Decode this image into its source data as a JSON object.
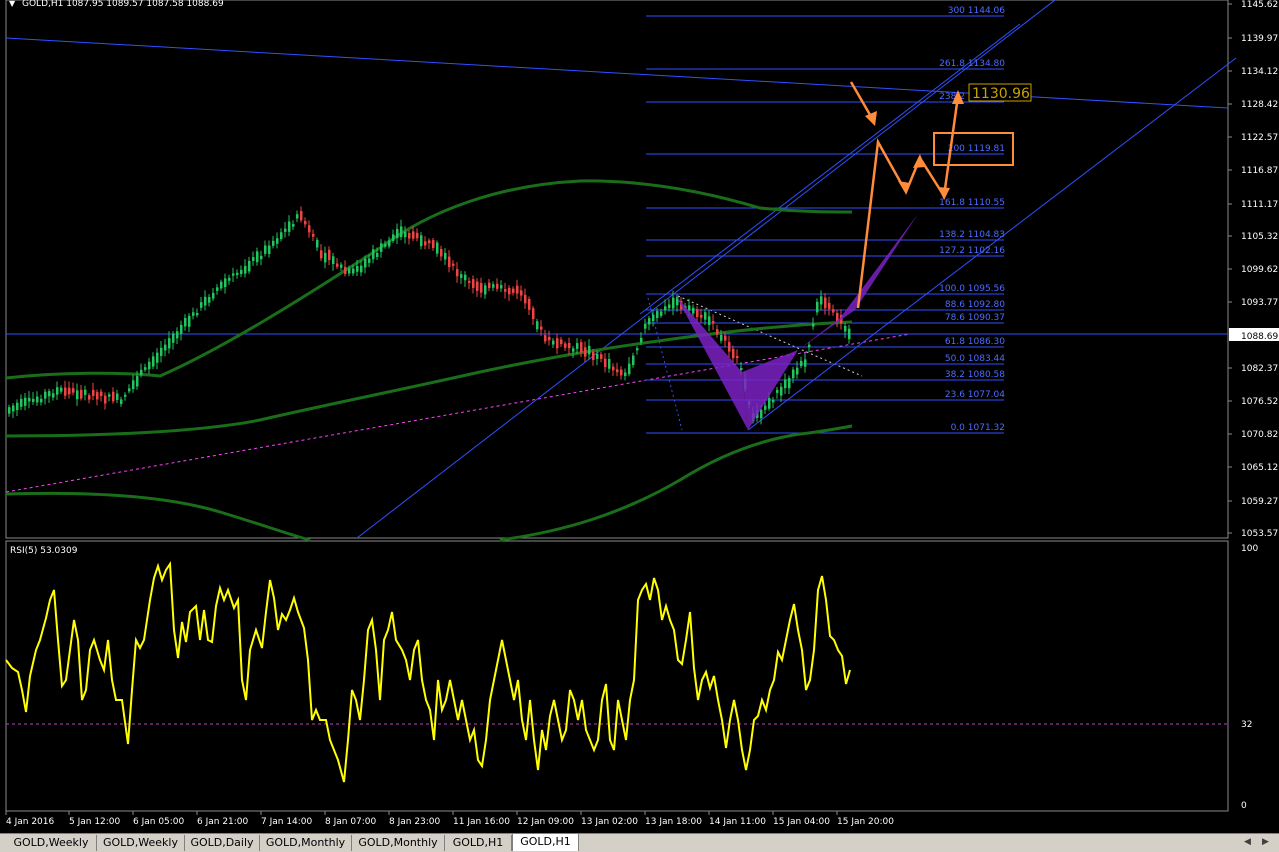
{
  "window": {
    "header": "GOLD,H1  1087.95 1089.57 1087.58 1088.69",
    "current_price": "1088.69",
    "target_box_label": "1130.96"
  },
  "price_axis": [
    "1145.62",
    "1139.97",
    "1134.12",
    "1128.42",
    "1122.57",
    "1116.87",
    "1111.17",
    "1105.32",
    "1099.62",
    "1093.77",
    "1082.37",
    "1076.52",
    "1070.82",
    "1065.12",
    "1059.27",
    "1053.57"
  ],
  "fib_levels": [
    {
      "label": "300 1144.06"
    },
    {
      "label": "261.8 1134.80"
    },
    {
      "label": "238.2 1129.08"
    },
    {
      "label": "200 1119.81"
    },
    {
      "label": "161.8 1110.55"
    },
    {
      "label": "138.2 1104.83"
    },
    {
      "label": "127.2 1102.16"
    },
    {
      "label": "100.0 1095.56"
    },
    {
      "label": "88.6 1092.80"
    },
    {
      "label": "78.6 1090.37"
    },
    {
      "label": "61.8 1086.30"
    },
    {
      "label": "50.0 1083.44"
    },
    {
      "label": "38.2 1080.58"
    },
    {
      "label": "23.6 1077.04"
    },
    {
      "label": "0.0 1071.32"
    }
  ],
  "rsi": {
    "label": "RSI(5) 53.0309",
    "axis": [
      "100",
      "32",
      "0"
    ]
  },
  "time_axis": [
    "4 Jan 2016",
    "5 Jan 12:00",
    "6 Jan 05:00",
    "6 Jan 21:00",
    "7 Jan 14:00",
    "8 Jan 07:00",
    "8 Jan 23:00",
    "11 Jan 16:00",
    "12 Jan 09:00",
    "13 Jan 02:00",
    "13 Jan 18:00",
    "14 Jan 11:00",
    "15 Jan 04:00",
    "15 Jan 20:00"
  ],
  "tabs": [
    {
      "label": "GOLD,Weekly",
      "active": false
    },
    {
      "label": "GOLD,Weekly",
      "active": false
    },
    {
      "label": "GOLD,Daily",
      "active": false
    },
    {
      "label": "GOLD,Monthly",
      "active": false
    },
    {
      "label": "GOLD,Monthly",
      "active": false
    },
    {
      "label": "GOLD,H1",
      "active": false
    },
    {
      "label": "GOLD,H1",
      "active": true
    }
  ],
  "colors": {
    "background": "#000000",
    "bull_candle": "#22c55e",
    "bear_candle": "#ef4444",
    "moving_average": "#1a6e1a",
    "channel": "#3050ff",
    "fib": "#3050ff",
    "fib_text": "#4d6cff",
    "rsi_line": "#ffff00",
    "projection": "#ff8c3a",
    "pattern": "#7b22c4",
    "trend_dashed": "#ff40ff"
  }
}
